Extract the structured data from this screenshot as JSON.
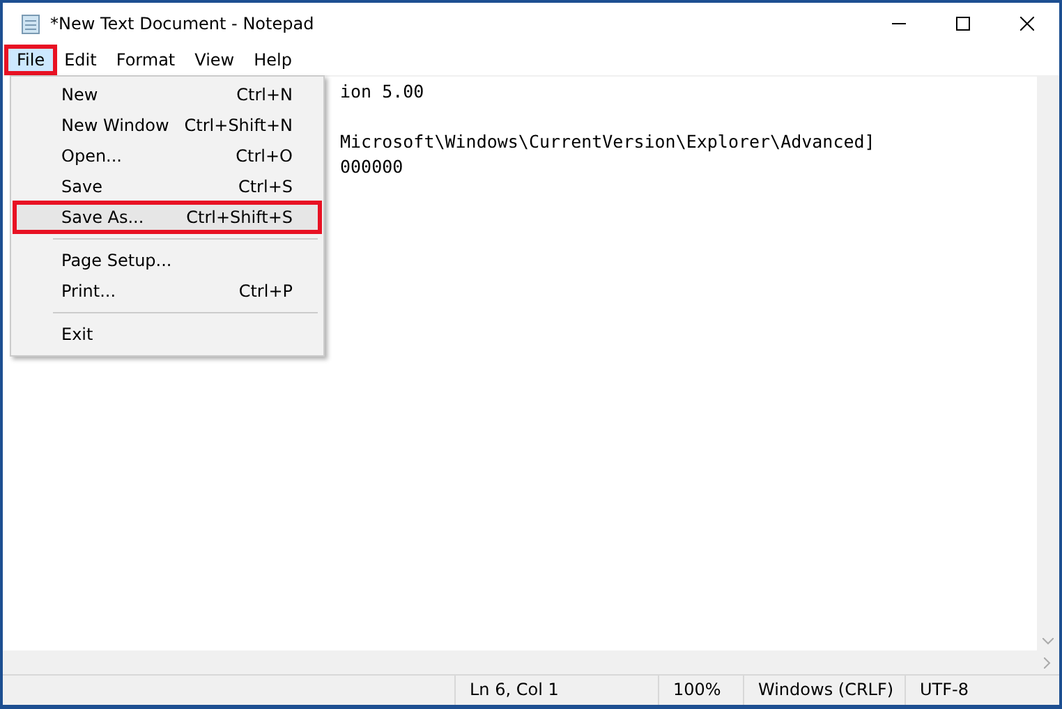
{
  "window": {
    "title": "*New Text Document - Notepad"
  },
  "menu_bar": [
    {
      "label": "File",
      "selected": true
    },
    {
      "label": "Edit",
      "selected": false
    },
    {
      "label": "Format",
      "selected": false
    },
    {
      "label": "View",
      "selected": false
    },
    {
      "label": "Help",
      "selected": false
    }
  ],
  "file_menu": [
    {
      "kind": "item",
      "label": "New",
      "shortcut": "Ctrl+N",
      "highlighted": false
    },
    {
      "kind": "item",
      "label": "New Window",
      "shortcut": "Ctrl+Shift+N",
      "highlighted": false
    },
    {
      "kind": "item",
      "label": "Open...",
      "shortcut": "Ctrl+O",
      "highlighted": false
    },
    {
      "kind": "item",
      "label": "Save",
      "shortcut": "Ctrl+S",
      "highlighted": false
    },
    {
      "kind": "item",
      "label": "Save As...",
      "shortcut": "Ctrl+Shift+S",
      "highlighted": true
    },
    {
      "kind": "separator"
    },
    {
      "kind": "item",
      "label": "Page Setup...",
      "highlighted": false
    },
    {
      "kind": "item",
      "label": "Print...",
      "shortcut": "Ctrl+P",
      "highlighted": false
    },
    {
      "kind": "separator"
    },
    {
      "kind": "item",
      "label": "Exit",
      "highlighted": false
    }
  ],
  "editor_paragraphs": [
    [
      "ion 5.00"
    ],
    [
      "Microsoft\\Windows\\CurrentVersion\\Explorer\\Advanced]",
      "000000"
    ]
  ],
  "status_bar": [
    "Ln 6, Col 1",
    "100%",
    "Windows (CRLF)",
    "UTF-8"
  ]
}
